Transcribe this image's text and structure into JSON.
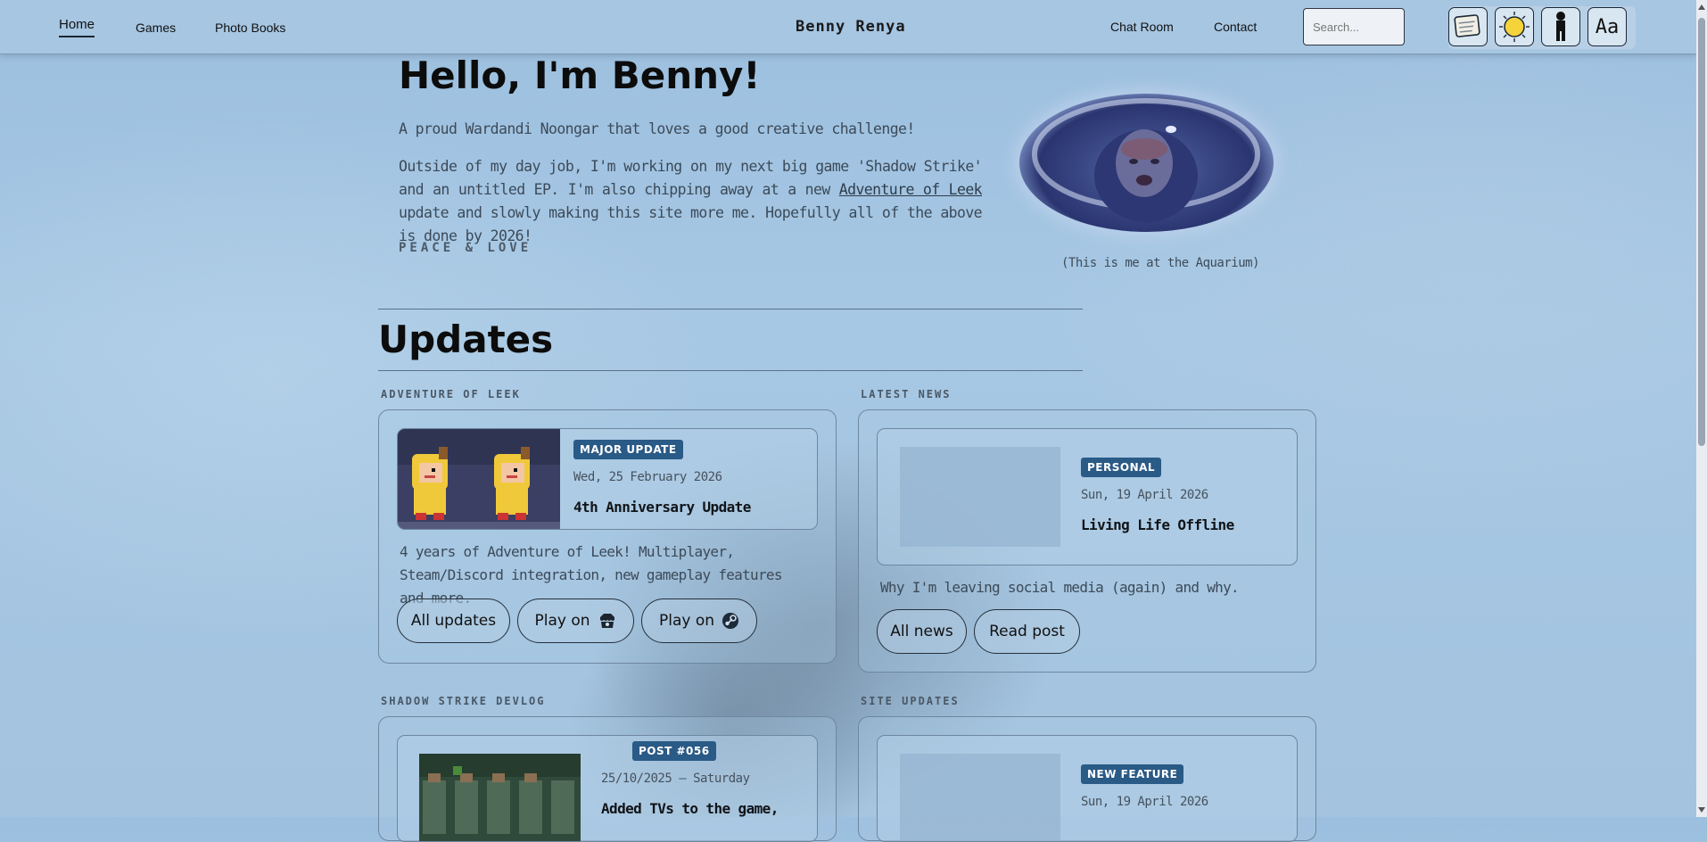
{
  "nav": {
    "home": "Home",
    "games": "Games",
    "photo_books": "Photo Books",
    "brand": "Benny Renya",
    "chat_room": "Chat Room",
    "contact": "Contact",
    "search_placeholder": "Search...",
    "tools": [
      "wallpaper-icon",
      "sun-icon",
      "figure-icon",
      "font-icon"
    ],
    "font_tool_label": "Aa"
  },
  "hero": {
    "heading": "Hello, I'm Benny!",
    "line1": "A proud Wardandi Noongar that loves a good creative challenge!",
    "line2_a": "Outside of my day job, I'm working on my next big game 'Shadow Strike' and an untitled EP. I'm also chipping away at a new ",
    "line2_link": "Adventure of Leek",
    "line2_b": " update and slowly making this site more me. Hopefully all of the above is done by 2026!",
    "signoff": "PEACE & LOVE",
    "photo_caption": "(This is me at the Aquarium)"
  },
  "updates": {
    "heading": "Updates",
    "leek": {
      "label": "ADVENTURE OF LEEK",
      "badge": "MAJOR UPDATE",
      "date": "Wed, 25 February 2026",
      "title": "4th Anniversary Update",
      "desc": "4 years of Adventure of Leek! Multiplayer, Steam/Discord integration, new gameplay features and more.",
      "btn_all": "All updates",
      "btn_play1": "Play on",
      "btn_play2": "Play on"
    },
    "news": {
      "label": "LATEST NEWS",
      "badge": "PERSONAL",
      "date": "Sun, 19 April 2026",
      "title": "Living Life Offline",
      "desc": "Why I'm leaving social media (again) and why.",
      "btn_all": "All news",
      "btn_read": "Read post"
    },
    "devlog": {
      "label": "SHADOW STRIKE DEVLOG",
      "badge": "POST #056",
      "date": "25/10/2025 — Saturday",
      "title": "Added TVs to the game,"
    },
    "site": {
      "label": "SITE UPDATES",
      "badge": "NEW FEATURE",
      "date": "Sun, 19 April 2026"
    }
  }
}
